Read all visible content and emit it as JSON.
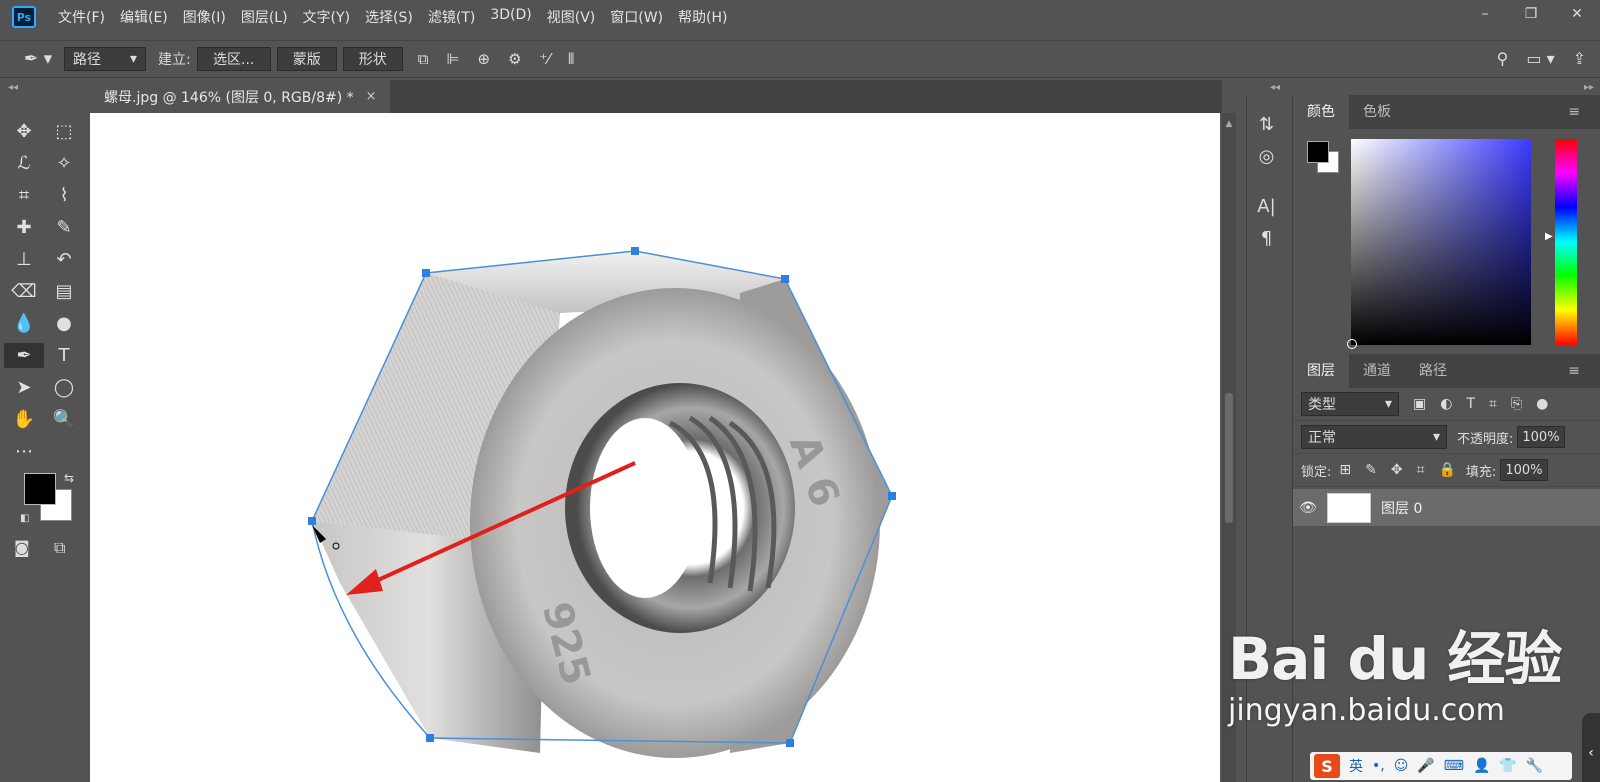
{
  "app": {
    "logo": "Ps"
  },
  "menu": [
    "文件(F)",
    "编辑(E)",
    "图像(I)",
    "图层(L)",
    "文字(Y)",
    "选择(S)",
    "滤镜(T)",
    "3D(D)",
    "视图(V)",
    "窗口(W)",
    "帮助(H)"
  ],
  "window_controls": {
    "minimize": "–",
    "restore": "❐",
    "close": "✕"
  },
  "options": {
    "mode_select": "路径",
    "make_label": "建立:",
    "selection_btn": "选区...",
    "mask_btn": "蒙版",
    "shape_btn": "形状"
  },
  "document": {
    "tab_title": "螺母.jpg @ 146% (图层 0, RGB/8#) *",
    "close": "×"
  },
  "color_panel": {
    "tabs": [
      "颜色",
      "色板"
    ]
  },
  "layers_panel": {
    "tabs": [
      "图层",
      "通道",
      "路径"
    ],
    "filter_kind": "类型",
    "blend_mode": "正常",
    "opacity_label": "不透明度:",
    "opacity": "100%",
    "lock_label": "锁定:",
    "fill_label": "填充:",
    "fill": "100%",
    "layers": [
      {
        "name": "图层 0"
      }
    ]
  },
  "canvas_text": {
    "nut_marking_1": "A 6",
    "nut_marking_2": "925"
  },
  "watermark": {
    "logo": "Bai du 经验",
    "url": "jingyan.baidu.com"
  },
  "ime": {
    "logo": "S",
    "lang": "英"
  },
  "colors": {
    "accent": "#31a8ff",
    "path": "#4a8fd8",
    "arrow": "#e0201a",
    "ui_bg": "#535353"
  }
}
